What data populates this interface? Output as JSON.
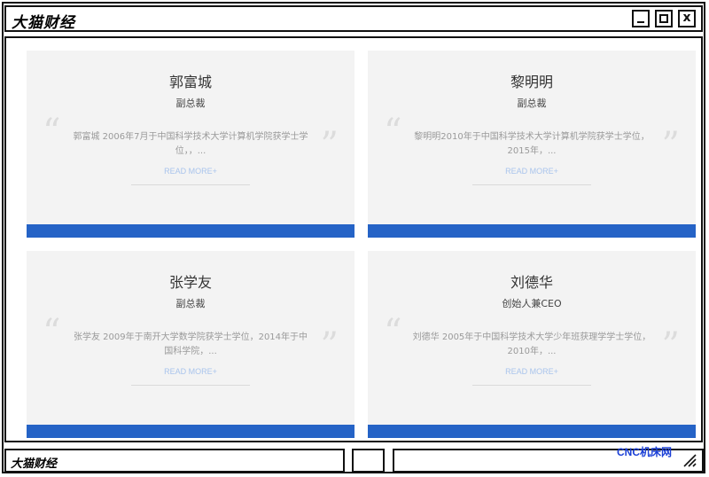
{
  "window": {
    "title": "大猫财经"
  },
  "cards": [
    {
      "name": "郭富城",
      "role": "副总裁",
      "description": "郭富城 2006年7月于中国科学技术大学计算机学院获学士学位，，...",
      "read_more": "READ MORE+"
    },
    {
      "name": "黎明明",
      "role": "副总裁",
      "description": "黎明明2010年于中国科学技术大学计算机学院获学士学位，2015年，...",
      "read_more": "READ MORE+"
    },
    {
      "name": "张学友",
      "role": "副总裁",
      "description": "张学友 2009年于南开大学数学院获学士学位，2014年于中国科学院，...",
      "read_more": "READ MORE+"
    },
    {
      "name": "刘德华",
      "role": "创始人兼CEO",
      "description": "刘德华 2005年于中国科学技术大学少年班获理学学士学位，2010年，...",
      "read_more": "READ MORE+"
    }
  ],
  "quote_open": "“",
  "quote_close": "”",
  "status": {
    "title": "大猫财经",
    "watermark": "CNC机床网"
  },
  "colors": {
    "accent_bar": "#2563c6",
    "card_bg": "#f3f3f3",
    "read_more": "#a9c4ec",
    "watermark": "#1a3fd6"
  },
  "icons": {
    "minimize": "minimize-icon",
    "maximize": "maximize-icon",
    "close": "close-icon",
    "resize": "resize-grip-icon"
  }
}
